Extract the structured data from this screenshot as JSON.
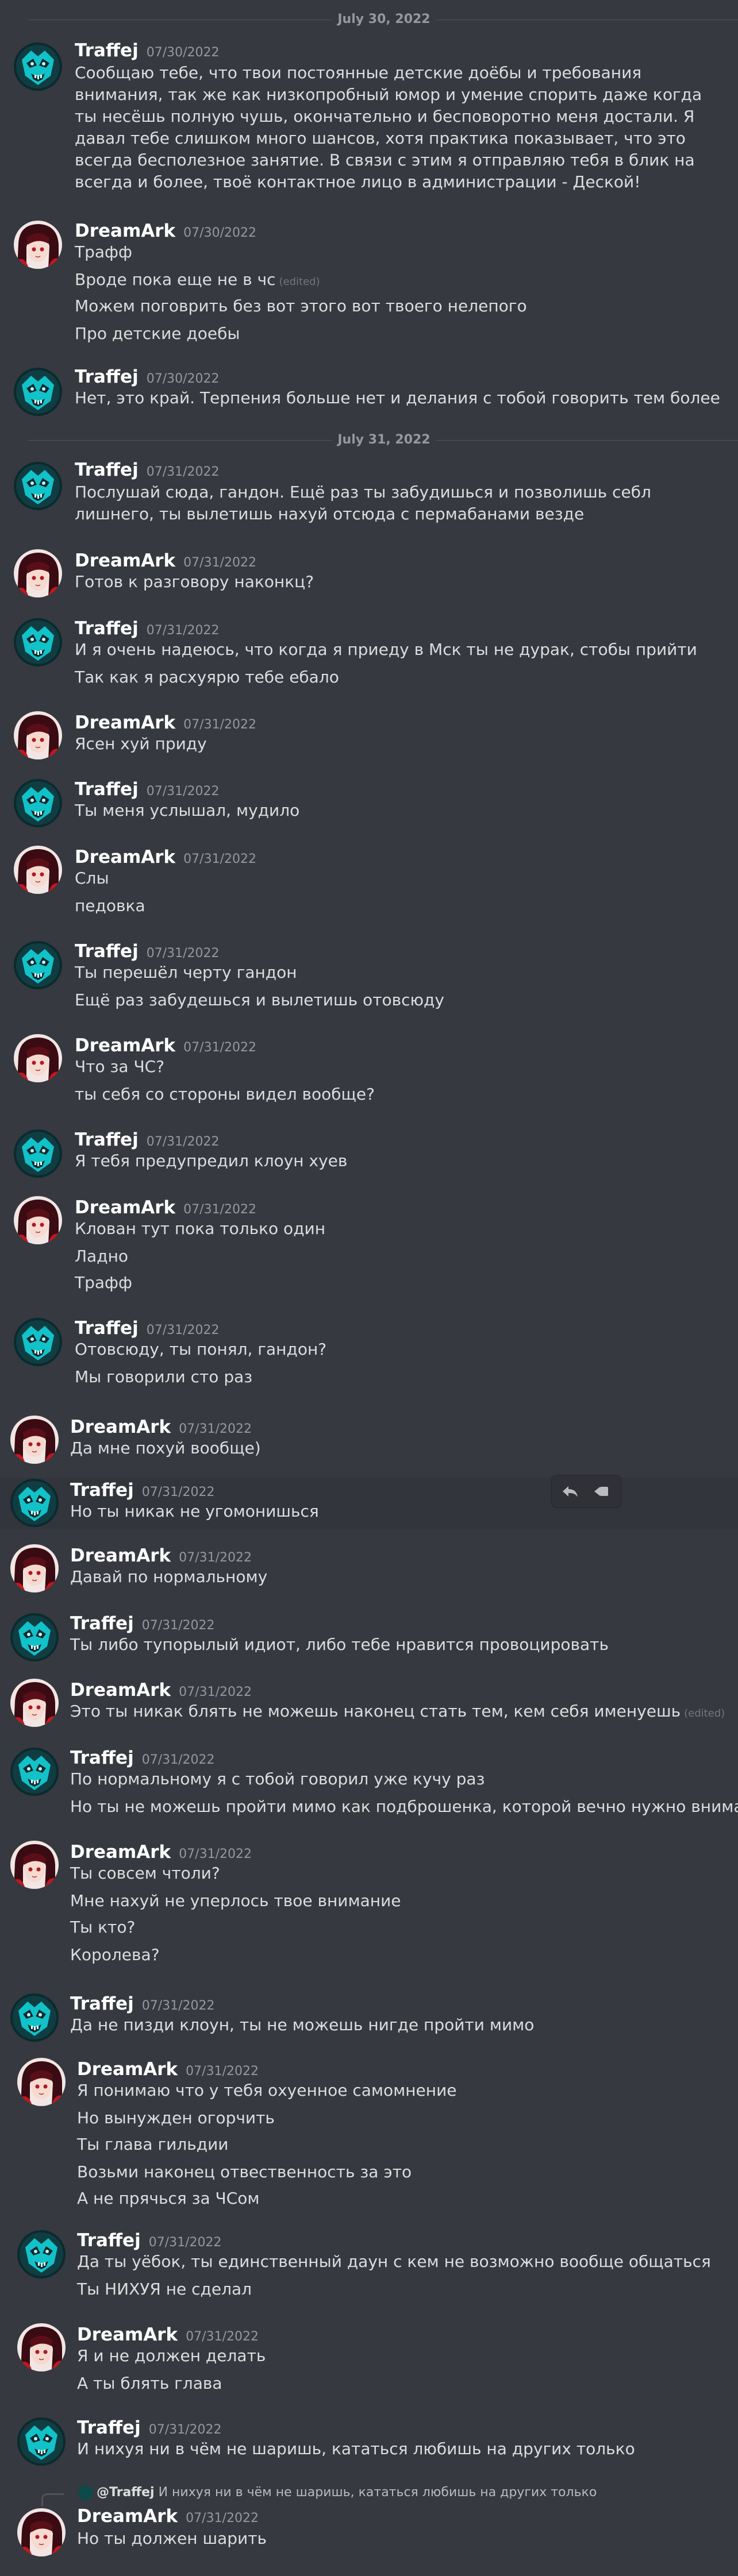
{
  "dividers": [
    "July 30, 2022",
    "July 31, 2022"
  ],
  "authors": {
    "traffej": "Traffej",
    "dreamark": "DreamArk"
  },
  "edited_label": "(edited)",
  "colors": {
    "background": "#36393f",
    "author": "#ffffff",
    "text": "#dcddde",
    "muted": "#96989d",
    "divider": "#4f545c"
  },
  "messages": [
    {
      "author": "Traffej",
      "time": "07/30/2022",
      "lines": [
        "Сообщаю тебе, что твои постоянные детские доёбы и требования внимания, так же как низкопробный юмор и умение спорить даже когда ты несёшь полную чушь, окончательно и бесповоротно меня достали. Я давал тебе слишком много шансов, хотя практика показывает, что это всегда бесполезное занятие. В связи с этим я отправляю тебя в блик на всегда и более, твоё контактное лицо в администрации - Деской!"
      ]
    },
    {
      "author": "DreamArk",
      "time": "07/30/2022",
      "lines": [
        "Трафф",
        "Вроде пока еще не в чс",
        "Можем поговрить без вот этого вот твоего нелепого",
        "Про детские доебы"
      ]
    },
    {
      "author": "Traffej",
      "time": "07/30/2022",
      "lines": [
        "Нет, это край. Терпения больше нет и делания с тобой говорить тем более"
      ]
    },
    {
      "author": "Traffej",
      "time": "07/31/2022",
      "lines": [
        "Послушай сюда, гандон. Ещё раз ты забудишься и позволишь себл лишнего, ты вылетишь нахуй отсюда с пермабанами везде"
      ]
    },
    {
      "author": "DreamArk",
      "time": "07/31/2022",
      "lines": [
        "Готов к разговору наконкц?"
      ]
    },
    {
      "author": "Traffej",
      "time": "07/31/2022",
      "lines": [
        "И я очень надеюсь, что когда я приеду в Мск ты не дурак, стобы прийти",
        "Так как я расхуярю тебе ебало"
      ]
    },
    {
      "author": "DreamArk",
      "time": "07/31/2022",
      "lines": [
        "Ясен хуй приду"
      ]
    },
    {
      "author": "Traffej",
      "time": "07/31/2022",
      "lines": [
        "Ты меня услышал, мудило"
      ]
    },
    {
      "author": "DreamArk",
      "time": "07/31/2022",
      "lines": [
        "Слы",
        "педовка"
      ]
    },
    {
      "author": "Traffej",
      "time": "07/31/2022",
      "lines": [
        "Ты перешёл черту гандон",
        "Ещё раз забудешься и вылетишь отовсюду"
      ]
    },
    {
      "author": "DreamArk",
      "time": "07/31/2022",
      "lines": [
        "Что за ЧС?",
        "ты себя со стороны видел вообще?"
      ]
    },
    {
      "author": "Traffej",
      "time": "07/31/2022",
      "lines": [
        "Я тебя предупредил клоун хуев"
      ]
    },
    {
      "author": "DreamArk",
      "time": "07/31/2022",
      "lines": [
        "Клован тут пока только один",
        "Ладно",
        "Трафф"
      ]
    },
    {
      "author": "Traffej",
      "time": "07/31/2022",
      "lines": [
        "Отовсюду, ты понял, гандон?",
        "Мы говорили сто раз"
      ]
    },
    {
      "author": "DreamArk",
      "time": "07/31/2022",
      "lines": [
        "Да мне похуй вообще)"
      ]
    },
    {
      "author": "Traffej",
      "time": "07/31/2022",
      "lines": [
        "Но ты никак не угомонишься"
      ]
    },
    {
      "author": "DreamArk",
      "time": "07/31/2022",
      "lines": [
        "Давай по нормальному"
      ]
    },
    {
      "author": "Traffej",
      "time": "07/31/2022",
      "lines": [
        "Ты либо тупорылый идиот, либо тебе нравится провоцировать"
      ]
    },
    {
      "author": "DreamArk",
      "time": "07/31/2022",
      "lines": [
        "Это ты никак блять не можешь наконец стать тем, кем себя именуешь"
      ]
    },
    {
      "author": "Traffej",
      "time": "07/31/2022",
      "lines": [
        "По нормальному я с тобой говорил уже кучу раз",
        "Но ты не можешь пройти мимо как подброшенка, которой вечно нужно внимание"
      ]
    },
    {
      "author": "DreamArk",
      "time": "07/31/2022",
      "lines": [
        "Ты совсем чтоли?",
        "Мне нахуй не уперлось твое внимание",
        "Ты кто?",
        "Королева?"
      ]
    },
    {
      "author": "Traffej",
      "time": "07/31/2022",
      "lines": [
        "Да не пизди клоун, ты не можешь нигде пройти мимо"
      ]
    },
    {
      "author": "DreamArk",
      "time": "07/31/2022",
      "lines": [
        "Я понимаю что у тебя охуенное самомнение",
        "Но вынужден огорчить",
        "Ты глава гильдии",
        "Возьми наконец отвественность за это",
        "А не прячься за ЧСом"
      ]
    },
    {
      "author": "Traffej",
      "time": "07/31/2022",
      "lines": [
        "Да ты уёбок, ты единственный даун с кем не возможно вообще общаться",
        "Ты НИХУЯ не сделал"
      ]
    },
    {
      "author": "DreamArk",
      "time": "07/31/2022",
      "lines": [
        "Я и не должен делать",
        "А ты блять глава"
      ]
    },
    {
      "author": "Traffej",
      "time": "07/31/2022",
      "lines": [
        "И нихуя ни в чём не шаришь, кататься любишь на других только"
      ]
    },
    {
      "author": "DreamArk",
      "time": "07/31/2022",
      "reply": {
        "name": "@Traffej",
        "text": "И нихуя ни в чём не шаришь, кататься любишь на других только"
      },
      "lines": [
        "Но ты должен шарить"
      ]
    }
  ],
  "toolbar_icons": [
    "reply-icon",
    "more-actions-icon"
  ],
  "icons": {
    "traffej_avatar": "teal-mask-avatar",
    "dreamark_avatar": "anime-girl-avatar"
  }
}
